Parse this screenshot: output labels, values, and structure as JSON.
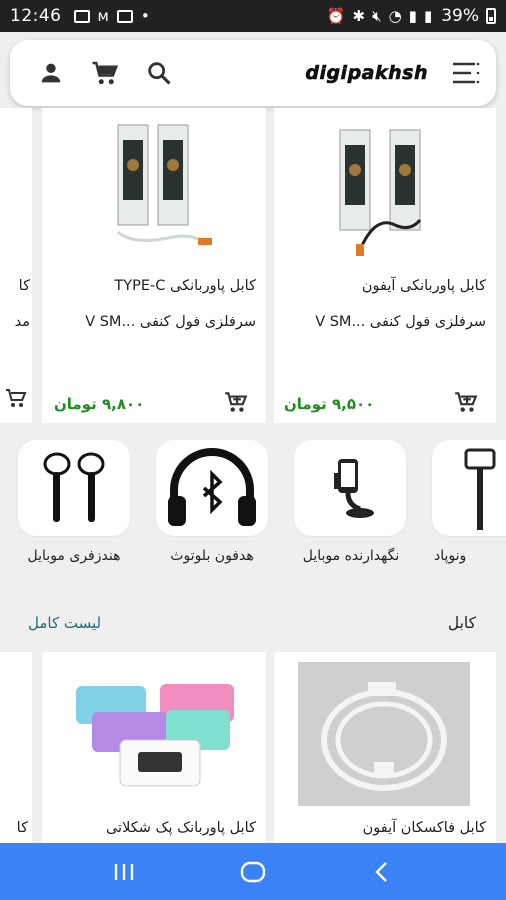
{
  "status_bar": {
    "time": "12:46",
    "battery": "39%"
  },
  "header": {
    "logo": "digipakhsh"
  },
  "top_products": [
    {
      "title_line1": "کابل پاوربانکی آیفون",
      "title_line2": "سرفلزی فول کنفی ...V SM",
      "price": "۹,۵۰۰ تومان"
    },
    {
      "title_line1": "کابل پاوربانکی TYPE-C",
      "title_line2": "سرفلزی فول کنفی ...V SM",
      "price": "۹,۸۰۰ تومان"
    },
    {
      "title_line1": "کا",
      "title_line2": "مد"
    }
  ],
  "categories": [
    {
      "label": "هندزفری موبایل",
      "icon": "earphones-icon"
    },
    {
      "label": "هدفون بلوتوث",
      "icon": "bluetooth-headphones-icon"
    },
    {
      "label": "نگهدارنده موبایل",
      "icon": "phone-holder-icon"
    },
    {
      "label": "ونوپاد",
      "icon": "selfie-stick-icon"
    }
  ],
  "section": {
    "title": "کابل",
    "link": "لیست کامل"
  },
  "bottom_products": [
    {
      "title": "کابل فاکسکان آیفون"
    },
    {
      "title": "کابل پاوربانک پک شکلاتی"
    },
    {
      "title": "کا"
    }
  ],
  "colors": {
    "price_green": "#1e8f1e",
    "link_teal": "#1c6f73",
    "nav_blue": "#3b82f6"
  }
}
